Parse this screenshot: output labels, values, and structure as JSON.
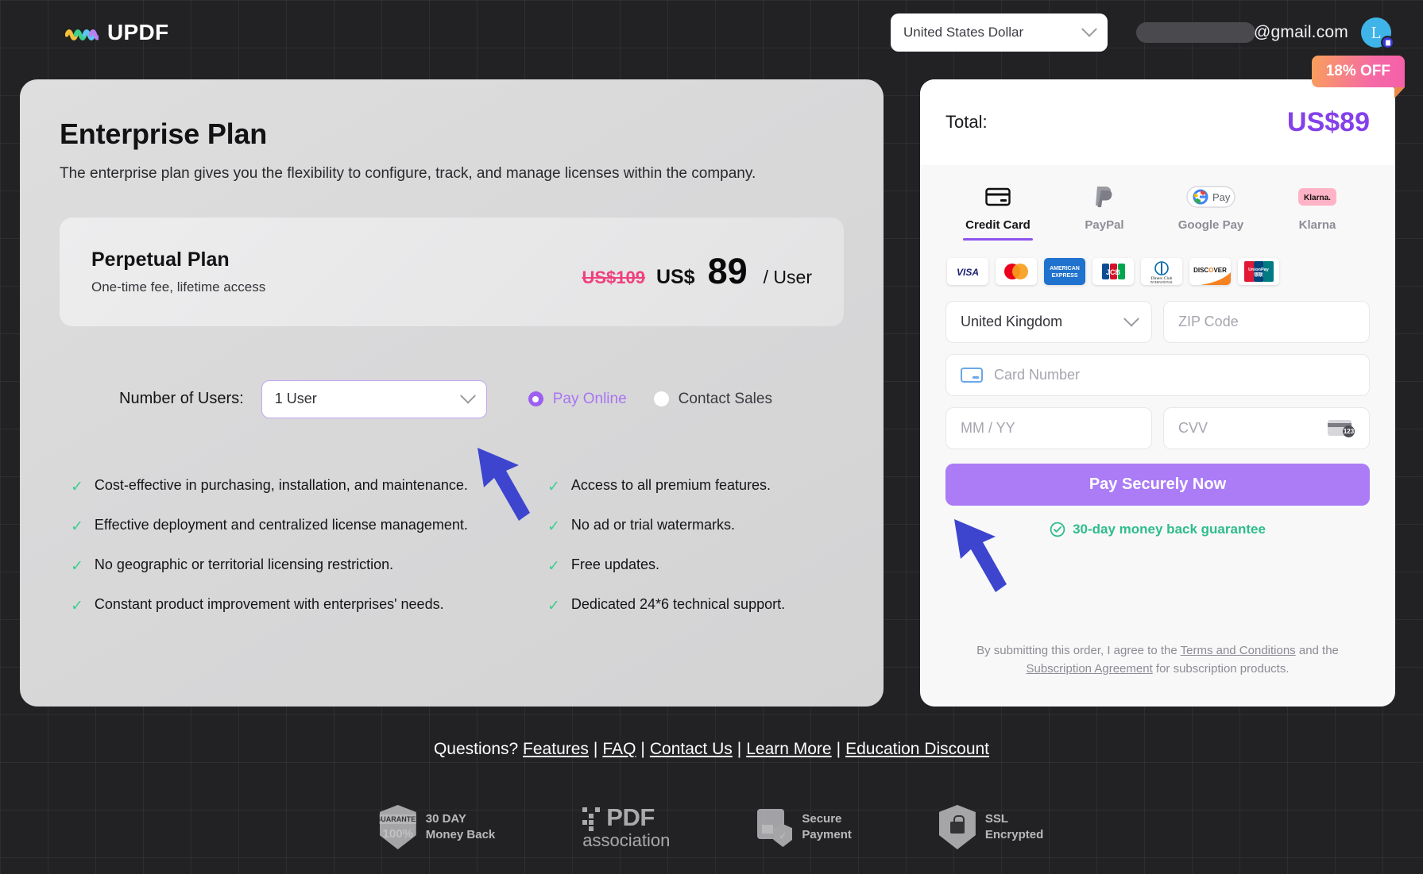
{
  "header": {
    "brand_name": "UPDF",
    "brand_logo_icon": "updf-wave-logo-icon",
    "currency": {
      "selected": "United States Dollar",
      "chevron_icon": "chevron-down-icon"
    },
    "account": {
      "email_suffix": "@gmail.com",
      "email_redacted": true,
      "avatar_initial": "L",
      "avatar_badge_icon": "document-badge-icon"
    }
  },
  "plan": {
    "title": "Enterprise Plan",
    "description": "The enterprise plan gives you the flexibility to configure, track, and manage licenses within the company.",
    "perpetual": {
      "name": "Perpetual Plan",
      "subtitle": "One-time fee, lifetime access",
      "old_price": "US$109",
      "currency": "US$",
      "amount": "89",
      "per": "/ User"
    },
    "users": {
      "label": "Number of Users:",
      "selected": "1 User",
      "chevron_icon": "chevron-down-icon"
    },
    "payment_options": [
      {
        "label": "Pay Online",
        "selected": true
      },
      {
        "label": "Contact Sales",
        "selected": false
      }
    ],
    "features_left": [
      "Cost-effective in purchasing, installation, and maintenance.",
      "Effective deployment and centralized license management.",
      "No geographic or territorial licensing restriction.",
      "Constant product improvement with enterprises' needs."
    ],
    "features_right": [
      "Access to all premium features.",
      "No ad or trial watermarks.",
      "Free updates.",
      "Dedicated 24*6 technical support."
    ],
    "check_icon": "check-icon"
  },
  "checkout": {
    "badge": "18% OFF",
    "total_label": "Total:",
    "total_value": "US$89",
    "methods": [
      {
        "label": "Credit Card",
        "icon": "credit-card-icon",
        "active": true
      },
      {
        "label": "PayPal",
        "icon": "paypal-icon",
        "active": false
      },
      {
        "label": "Google Pay",
        "icon": "google-pay-icon",
        "active": false
      },
      {
        "label": "Klarna",
        "icon": "klarna-icon",
        "active": false
      }
    ],
    "card_brands": [
      "visa",
      "mastercard",
      "american-express",
      "jcb",
      "diners-club",
      "discover",
      "unionpay"
    ],
    "fields": {
      "country_value": "United Kingdom",
      "country_chevron_icon": "chevron-down-icon",
      "zip_placeholder": "ZIP Code",
      "card_number_placeholder": "Card Number",
      "card_number_icon": "credit-card-icon",
      "expiry_placeholder": "MM / YY",
      "cvv_placeholder": "CVV",
      "cvv_icon": "card-back-cvv-icon",
      "cvv_icon_text": "123"
    },
    "pay_button": "Pay Securely Now",
    "guarantee_text": "30-day money back guarantee",
    "guarantee_icon": "shield-check-icon",
    "terms": {
      "part1": "By submitting this order, I agree to the ",
      "link1": "Terms and Conditions",
      "part2": " and the ",
      "link2": "Subscription Agreement",
      "part3": " for subscription products."
    }
  },
  "footer": {
    "questions_label": "Questions?",
    "links": [
      "Features",
      "FAQ",
      "Contact Us",
      "Learn More",
      "Education Discount"
    ],
    "separator": "|",
    "trust_badges": [
      {
        "icon": "guarantee-shield-icon",
        "line1": "30 DAY",
        "line2": "Money Back",
        "shield_top": "GUARANTEE",
        "shield_main": "100%"
      },
      {
        "icon": "pdf-association-icon",
        "line1": "PDF",
        "line2": "association"
      },
      {
        "icon": "secure-payment-icon",
        "line1": "Secure",
        "line2": "Payment"
      },
      {
        "icon": "ssl-lock-icon",
        "line1": "SSL",
        "line2": "Encrypted"
      }
    ]
  },
  "annotations": {
    "arrow_color": "#3d45cf",
    "arrow_1_target": "number-of-users-select",
    "arrow_2_target": "pay-securely-now-button"
  }
}
